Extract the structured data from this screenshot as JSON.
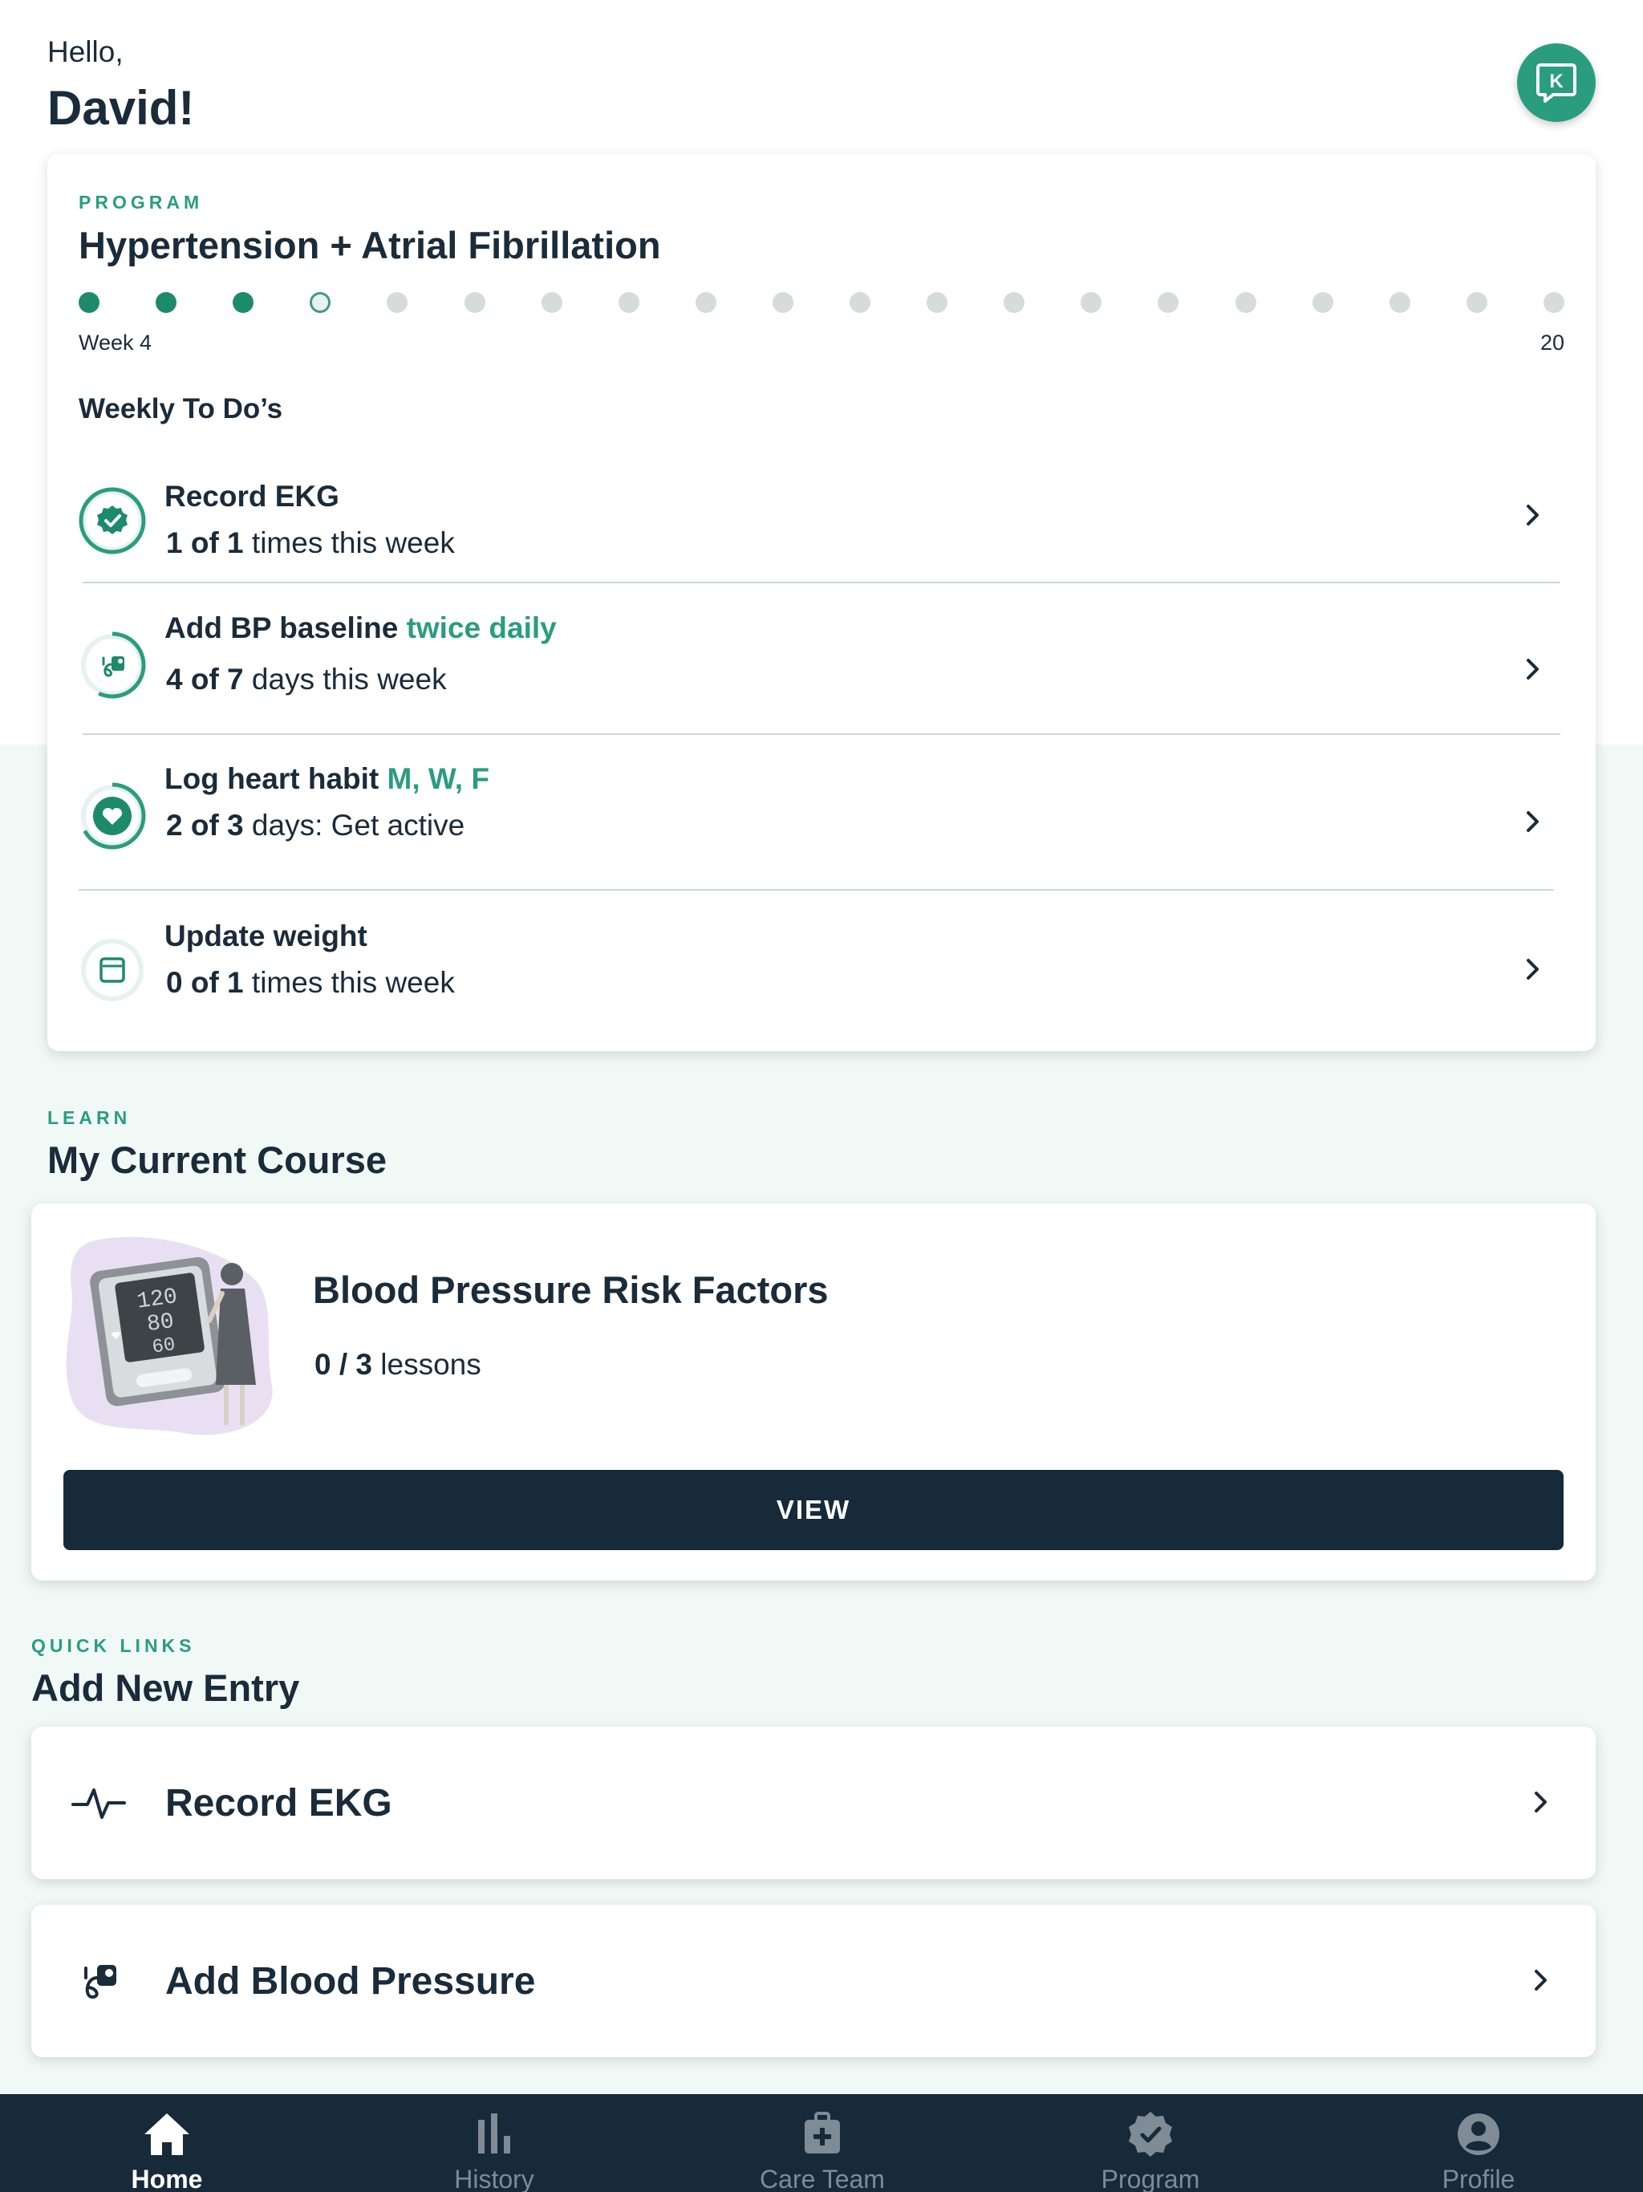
{
  "greeting": {
    "hello": "Hello,",
    "name": "David!"
  },
  "chat_button": {
    "letter": "K"
  },
  "program": {
    "eyebrow": "PROGRAM",
    "title": "Hypertension + Atrial Fibrillation",
    "total_weeks": 20,
    "current_week": 4,
    "week_start_label": "Week 4",
    "week_end_label": "20",
    "todos_heading": "Weekly To Do’s",
    "todos": [
      {
        "title": "Record EKG",
        "highlight": "",
        "count": "1 of 1",
        "suffix": " times this week",
        "progress": 1.0
      },
      {
        "title": "Add BP baseline ",
        "highlight": "twice daily",
        "count": "4 of 7",
        "suffix": " days this week",
        "progress": 0.57
      },
      {
        "title": "Log heart habit ",
        "highlight": "M, W, F",
        "count": "2 of 3",
        "suffix": " days: Get active",
        "progress": 0.67
      },
      {
        "title": "Update weight",
        "highlight": "",
        "count": "0 of 1",
        "suffix": " times this week",
        "progress": 0.0
      }
    ]
  },
  "learn": {
    "eyebrow": "LEARN",
    "title": "My Current Course",
    "course_title": "Blood Pressure Risk Factors",
    "progress_count": "0 / 3",
    "progress_suffix": " lessons",
    "button_label": "VIEW"
  },
  "quick_links": {
    "eyebrow": "QUICK LINKS",
    "title": "Add New Entry",
    "items": [
      {
        "label": "Record EKG",
        "icon": "ekg-icon"
      },
      {
        "label": "Add Blood Pressure",
        "icon": "blood-pressure-cuff-icon"
      }
    ]
  },
  "tabbar": {
    "tabs": [
      {
        "label": "Home",
        "icon": "home-icon",
        "active": true
      },
      {
        "label": "History",
        "icon": "bar-chart-icon",
        "active": false
      },
      {
        "label": "Care Team",
        "icon": "medical-bag-icon",
        "active": false
      },
      {
        "label": "Program",
        "icon": "badge-check-icon",
        "active": false
      },
      {
        "label": "Profile",
        "icon": "person-icon",
        "active": false
      }
    ]
  },
  "colors": {
    "accent": "#2a9d7f",
    "dark": "#172a3a",
    "background_tint": "#f1f9f7"
  }
}
